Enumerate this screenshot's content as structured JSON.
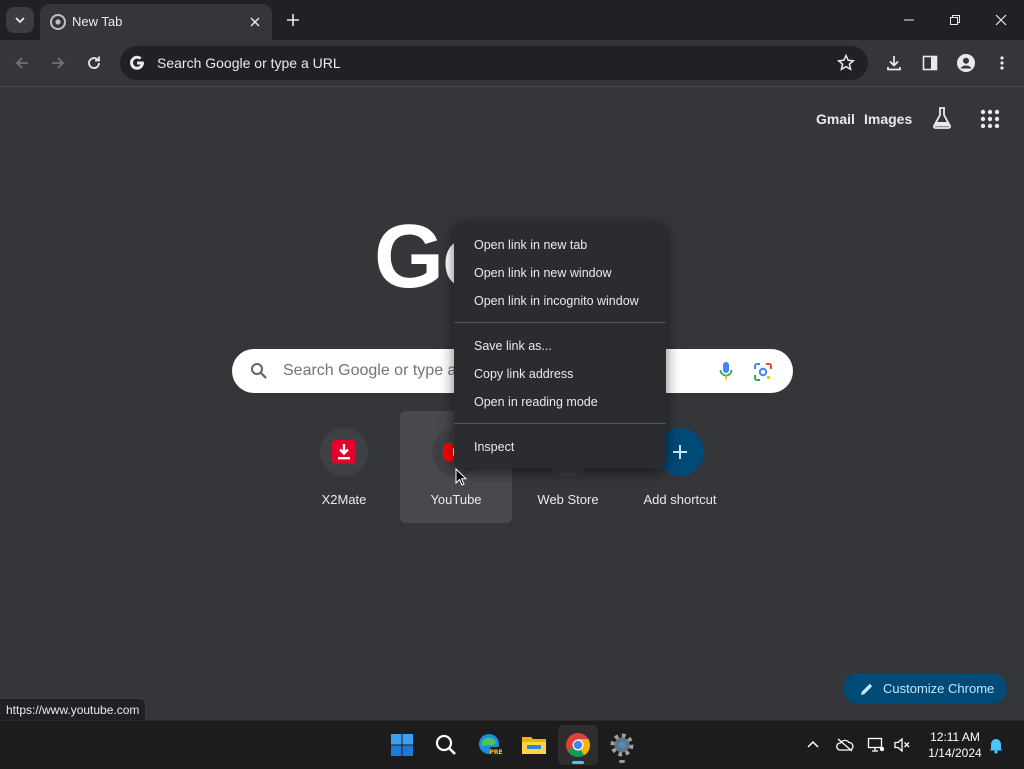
{
  "tab": {
    "title": "New Tab"
  },
  "omnibox": {
    "placeholder": "Search Google or type a URL"
  },
  "ntp": {
    "links": {
      "gmail": "Gmail",
      "images": "Images"
    },
    "logo_text": "Go",
    "search_placeholder": "Search Google or type a",
    "shortcuts": [
      {
        "label": "X2Mate"
      },
      {
        "label": "YouTube"
      },
      {
        "label": "Web Store"
      },
      {
        "label": "Add shortcut"
      }
    ],
    "customize_label": "Customize Chrome"
  },
  "context_menu": {
    "items": [
      "Open link in new tab",
      "Open link in new window",
      "Open link in incognito window",
      "Save link as...",
      "Copy link address",
      "Open in reading mode",
      "Inspect"
    ]
  },
  "status_url": "https://www.youtube.com",
  "clock": {
    "time": "12:11 AM",
    "date": "1/14/2024"
  },
  "colors": {
    "accent": "#8ab4f8",
    "youtube_red": "#ff0000",
    "customize_bg": "#004a77",
    "taskbar": "#1c1c1c"
  },
  "icons": [
    "tab-search-icon",
    "chrome-favicon-icon",
    "close-icon",
    "plus-icon",
    "minimize-icon",
    "restore-icon",
    "back-icon",
    "forward-icon",
    "reload-icon",
    "google-g-icon",
    "star-icon",
    "download-icon",
    "side-panel-icon",
    "profile-icon",
    "kebab-menu-icon",
    "labs-flask-icon",
    "apps-grid-icon",
    "search-icon",
    "mic-icon",
    "lens-icon",
    "pencil-icon",
    "windows-start-icon",
    "edge-icon",
    "explorer-icon",
    "settings-gear-icon",
    "chevron-up-icon",
    "onedrive-icon",
    "network-icon",
    "volume-muted-icon",
    "notification-bell-icon"
  ]
}
